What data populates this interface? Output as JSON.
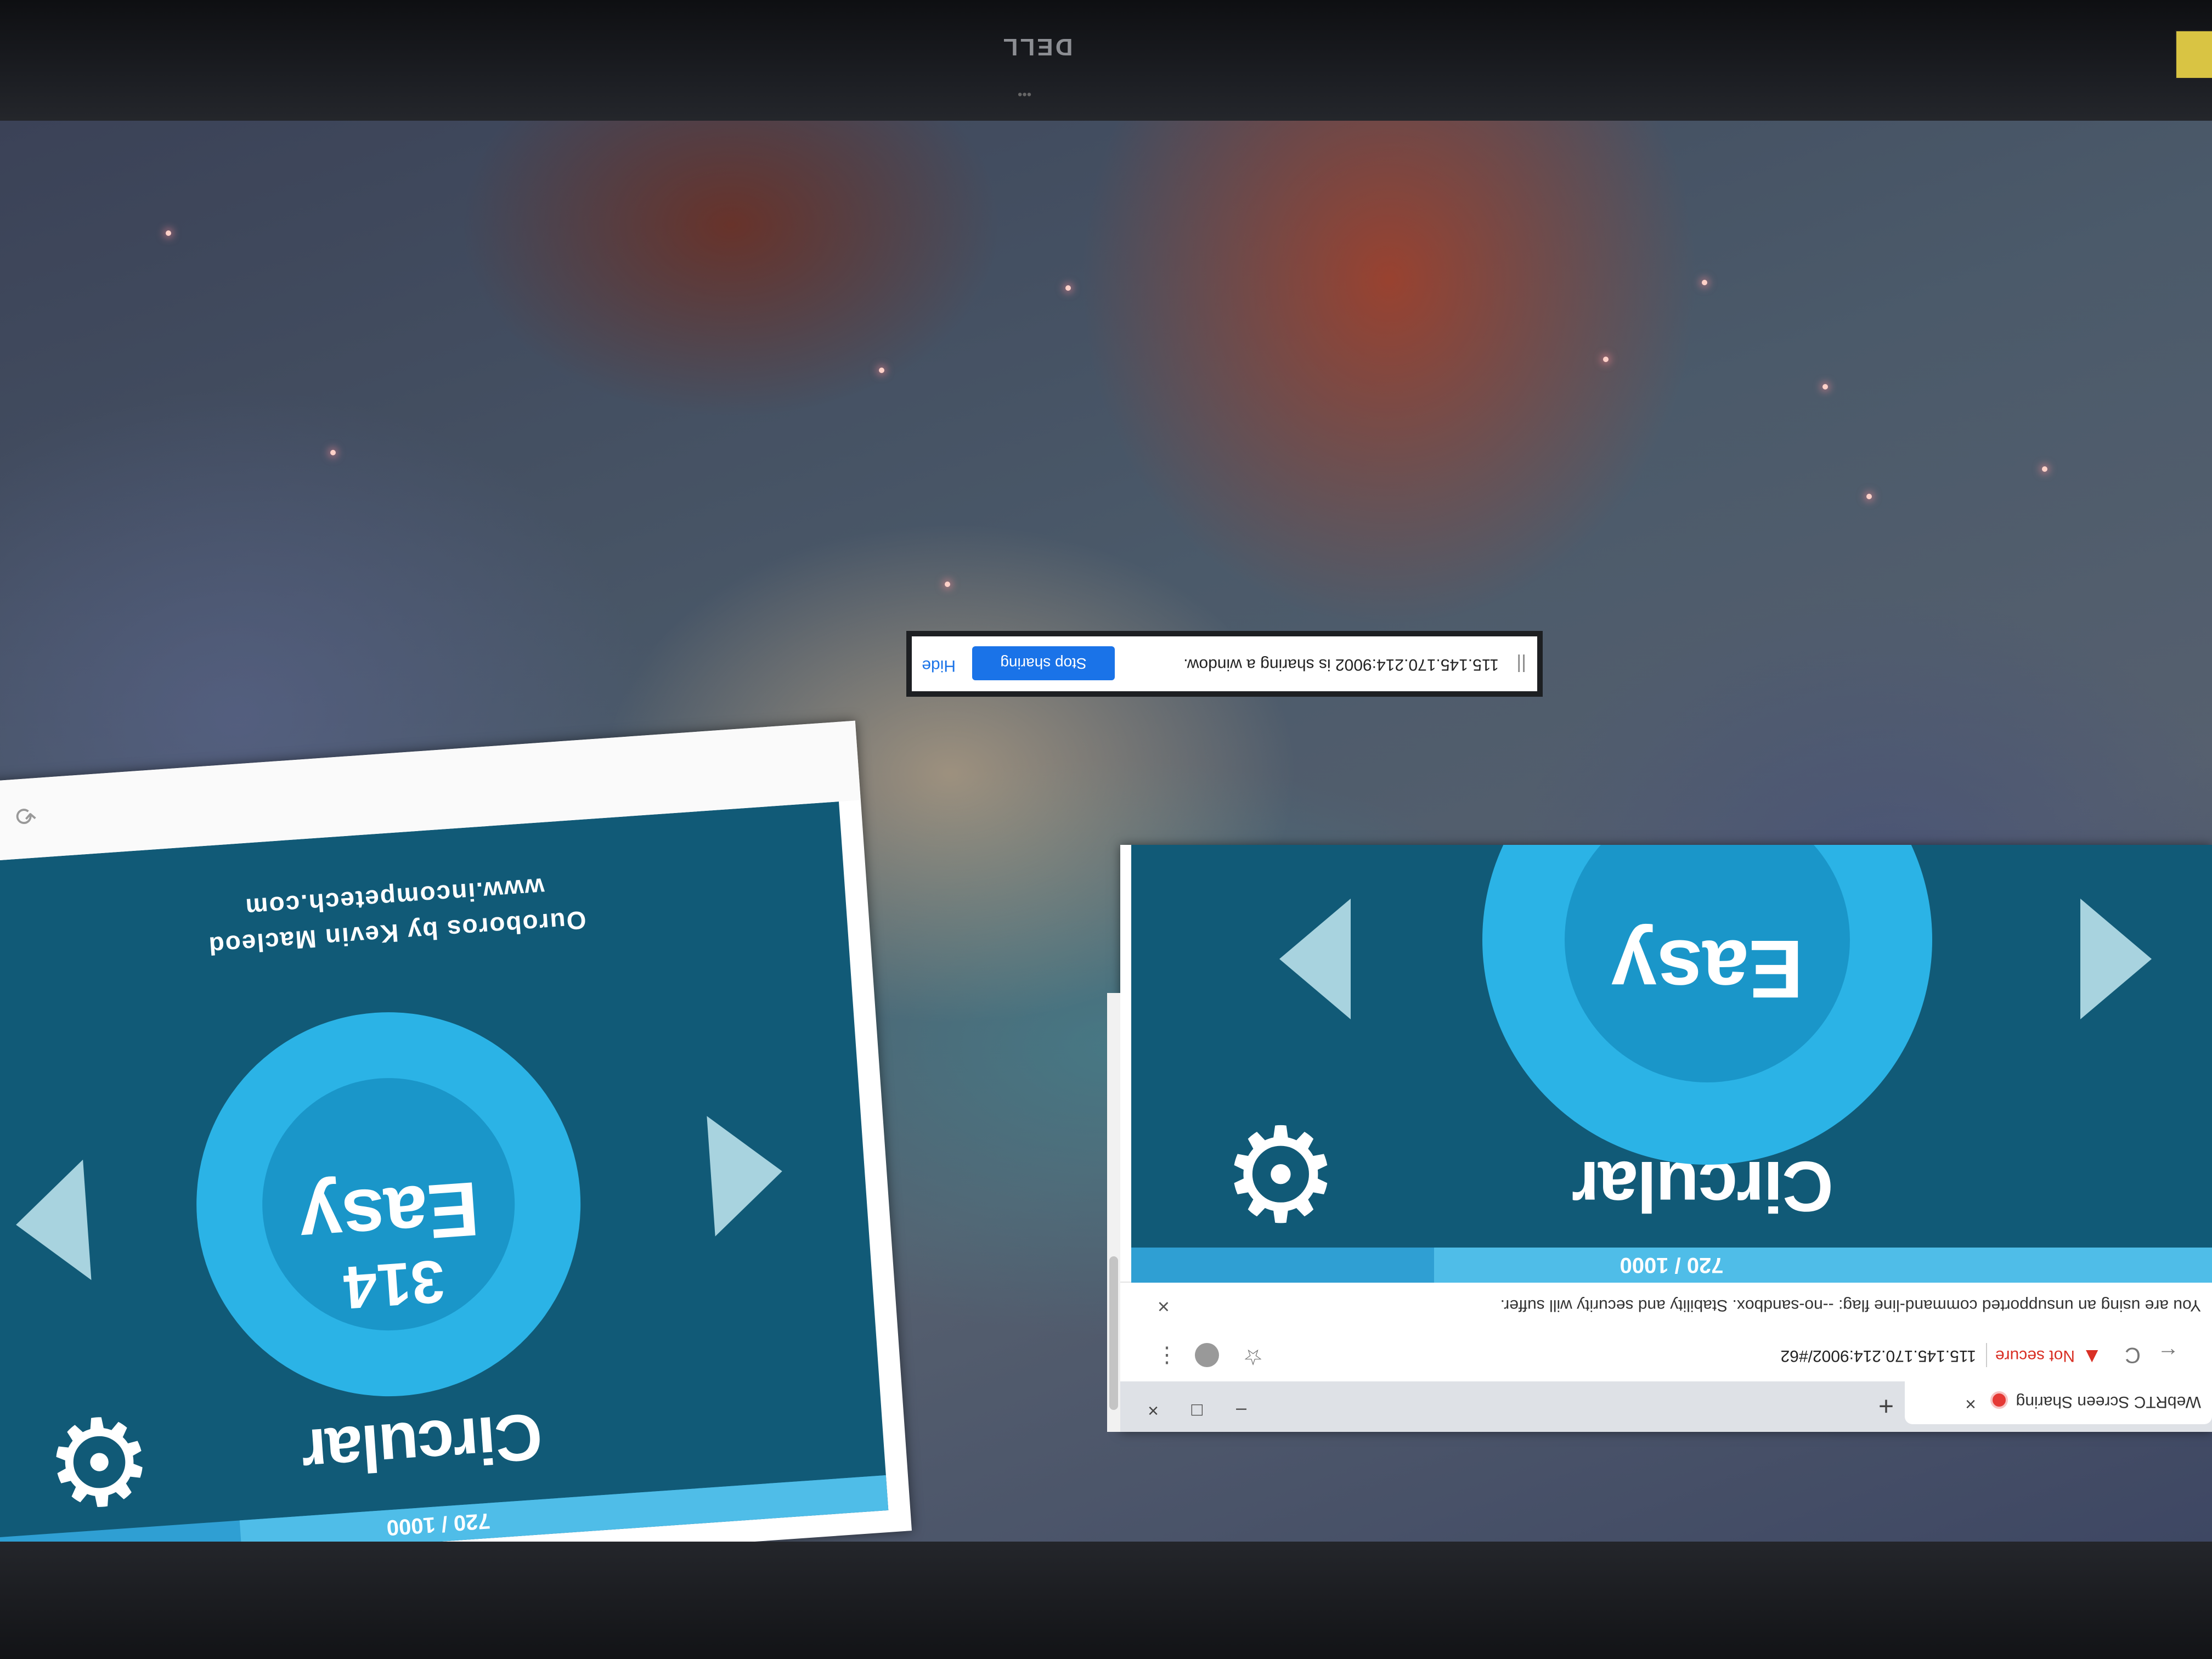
{
  "monitor": {
    "brand": "DELL"
  },
  "browser": {
    "tab_title": "WebRTC Screen Sharing",
    "tab_close": "×",
    "new_tab": "+",
    "window_controls": {
      "minimize": "–",
      "maximize": "□",
      "close": "×"
    },
    "back": "←",
    "reload": "C",
    "warning_icon": "▲",
    "not_secure": "Not secure",
    "url": "115.145.170.214:9002/#62",
    "bookmark_icon": "☆",
    "menu_icon": "⋮",
    "infobar_text": "You are using an unsupported command-line flag: --no-sandbox. Stability and security will suffer.",
    "infobar_close": "×"
  },
  "game": {
    "progress": "720 / 1000",
    "progress_fraction": 0.72,
    "title": "Circular",
    "gear_icon": "⚙",
    "level_name": "Easy",
    "level_number": "314",
    "level_number_partial": "314",
    "credit_line1": "Ouroboros by Kevin Macleod",
    "credit_line2": "www.incompetech.com",
    "prev_arrow": "previous",
    "next_arrow": "next"
  },
  "share_bar": {
    "grip": "||",
    "message": "115.145.170.214:9002 is sharing a window.",
    "stop_button": "Stop sharing",
    "hide_button": "Hide"
  },
  "colors": {
    "game_bg": "#115a77",
    "ring_outer": "#2bb3e6",
    "ring_inner": "#1a96c9",
    "progress": "#4fbde8",
    "stop_button": "#1a73e8",
    "not_secure": "#d93025"
  }
}
